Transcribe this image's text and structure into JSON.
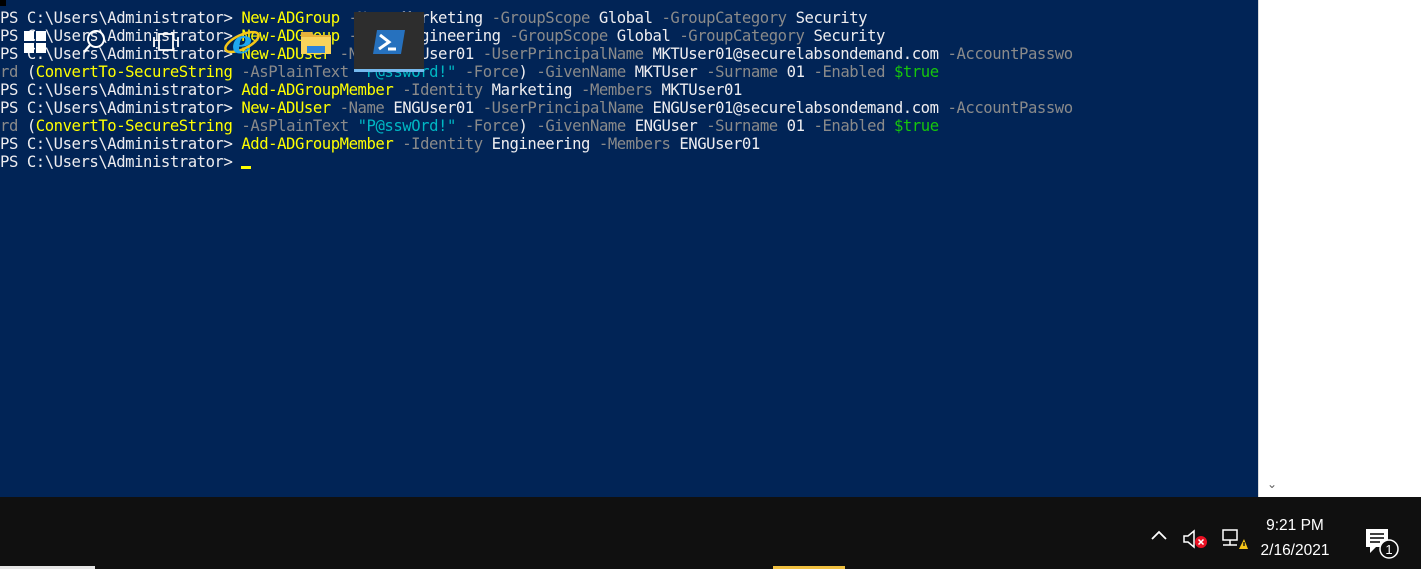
{
  "console": {
    "lines": [
      [
        {
          "t": "prompt",
          "text": "PS C:\\Users\\Administrator> "
        },
        {
          "t": "cmd",
          "text": "New-ADGroup"
        },
        {
          "t": "param",
          "text": " -Name "
        },
        {
          "t": "arg",
          "text": "Marketing"
        },
        {
          "t": "param",
          "text": " -GroupScope "
        },
        {
          "t": "arg",
          "text": "Global"
        },
        {
          "t": "param",
          "text": " -GroupCategory "
        },
        {
          "t": "arg",
          "text": "Security"
        }
      ],
      [
        {
          "t": "prompt",
          "text": "PS C:\\Users\\Administrator> "
        },
        {
          "t": "cmd",
          "text": "New-ADGroup"
        },
        {
          "t": "param",
          "text": " -Name "
        },
        {
          "t": "arg",
          "text": "Engineering"
        },
        {
          "t": "param",
          "text": " -GroupScope "
        },
        {
          "t": "arg",
          "text": "Global"
        },
        {
          "t": "param",
          "text": " -GroupCategory "
        },
        {
          "t": "arg",
          "text": "Security"
        }
      ],
      [
        {
          "t": "prompt",
          "text": "PS C:\\Users\\Administrator> "
        },
        {
          "t": "cmd",
          "text": "New-ADUser"
        },
        {
          "t": "param",
          "text": " -Name "
        },
        {
          "t": "arg",
          "text": "MKTUser01"
        },
        {
          "t": "param",
          "text": " -UserPrincipalName "
        },
        {
          "t": "arg",
          "text": "MKTUser01@securelabsondemand.com"
        },
        {
          "t": "param",
          "text": " -AccountPasswo"
        }
      ],
      [
        {
          "t": "param",
          "text": "rd "
        },
        {
          "t": "arg",
          "text": "("
        },
        {
          "t": "cmd",
          "text": "ConvertTo-SecureString"
        },
        {
          "t": "param",
          "text": " -AsPlainText "
        },
        {
          "t": "str",
          "text": "\"P@sswOrd!\""
        },
        {
          "t": "param",
          "text": " -Force"
        },
        {
          "t": "arg",
          "text": ") "
        },
        {
          "t": "param",
          "text": "-GivenName "
        },
        {
          "t": "arg",
          "text": "MKTUser"
        },
        {
          "t": "param",
          "text": " -Surname "
        },
        {
          "t": "arg",
          "text": "01"
        },
        {
          "t": "param",
          "text": " -Enabled "
        },
        {
          "t": "var",
          "text": "$true"
        }
      ],
      [
        {
          "t": "prompt",
          "text": "PS C:\\Users\\Administrator> "
        },
        {
          "t": "cmd",
          "text": "Add-ADGroupMember"
        },
        {
          "t": "param",
          "text": " -Identity "
        },
        {
          "t": "arg",
          "text": "Marketing"
        },
        {
          "t": "param",
          "text": " -Members "
        },
        {
          "t": "arg",
          "text": "MKTUser01"
        }
      ],
      [
        {
          "t": "prompt",
          "text": "PS C:\\Users\\Administrator> "
        },
        {
          "t": "cmd",
          "text": "New-ADUser"
        },
        {
          "t": "param",
          "text": " -Name "
        },
        {
          "t": "arg",
          "text": "ENGUser01"
        },
        {
          "t": "param",
          "text": " -UserPrincipalName "
        },
        {
          "t": "arg",
          "text": "ENGUser01@securelabsondemand.com"
        },
        {
          "t": "param",
          "text": " -AccountPasswo"
        }
      ],
      [
        {
          "t": "param",
          "text": "rd "
        },
        {
          "t": "arg",
          "text": "("
        },
        {
          "t": "cmd",
          "text": "ConvertTo-SecureString"
        },
        {
          "t": "param",
          "text": " -AsPlainText "
        },
        {
          "t": "str",
          "text": "\"P@sswOrd!\""
        },
        {
          "t": "param",
          "text": " -Force"
        },
        {
          "t": "arg",
          "text": ") "
        },
        {
          "t": "param",
          "text": "-GivenName "
        },
        {
          "t": "arg",
          "text": "ENGUser"
        },
        {
          "t": "param",
          "text": " -Surname "
        },
        {
          "t": "arg",
          "text": "01"
        },
        {
          "t": "param",
          "text": " -Enabled "
        },
        {
          "t": "var",
          "text": "$true"
        }
      ],
      [
        {
          "t": "prompt",
          "text": "PS C:\\Users\\Administrator> "
        },
        {
          "t": "cmd",
          "text": "Add-ADGroupMember"
        },
        {
          "t": "param",
          "text": " -Identity "
        },
        {
          "t": "arg",
          "text": "Engineering"
        },
        {
          "t": "param",
          "text": " -Members "
        },
        {
          "t": "arg",
          "text": "ENGUser01"
        }
      ],
      [
        {
          "t": "prompt",
          "text": "PS C:\\Users\\Administrator> "
        }
      ]
    ]
  },
  "taskbar": {
    "apps": [
      {
        "name": "start-button",
        "icon": "windows-logo-icon"
      },
      {
        "name": "search-button",
        "icon": "search-icon"
      },
      {
        "name": "task-view-button",
        "icon": "task-view-icon"
      },
      {
        "name": "internet-explorer-button",
        "icon": "internet-explorer-icon"
      },
      {
        "name": "file-explorer-button",
        "icon": "file-explorer-icon"
      },
      {
        "name": "powershell-button",
        "icon": "powershell-icon",
        "active": true
      }
    ],
    "tray": {
      "time": "9:21 PM",
      "date": "2/16/2021",
      "notification_count": "1"
    }
  },
  "colors": {
    "console_bg": "#012456",
    "command": "#ffff00",
    "parameter": "#8a8a8a",
    "string": "#00b7c3",
    "variable": "#16c60c",
    "taskbar_bg": "#101010",
    "accent": "#76b9ed"
  }
}
